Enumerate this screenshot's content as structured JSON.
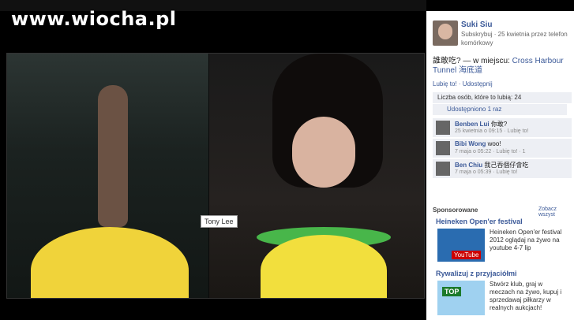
{
  "watermark": "www.wiocha.pl",
  "photo": {
    "tag_label": "Tony Lee"
  },
  "post": {
    "author": "Suki Siu",
    "subtitle": "Subskrybuj · 25 kwietnia przez telefon komórkowy",
    "text": "誰敢吃? — w miejscu:",
    "place": "Cross Harbour Tunnel 海底道",
    "actions": "Lubię to! · Udostępnij",
    "likes": "Liczba osób, które to lubią: 24",
    "shares": "Udostępniono 1 raz"
  },
  "comments": [
    {
      "name": "Benben Lui",
      "text": "你敢?",
      "meta": "25 kwietnia o 09:15 · Lubię to!"
    },
    {
      "name": "Bibi Wong",
      "text": "woo!",
      "meta": "7 maja o 05:22 · Lubię to! · 1"
    },
    {
      "name": "Ben Chiu",
      "text": "我己吞個仔會吃",
      "meta": "7 maja o 05:39 · Lubię to!"
    }
  ],
  "sidebar": {
    "sponsored": "Sponsorowane",
    "see_all": "Zobacz wszyst",
    "ad1": {
      "title": "Heineken Open'er festival",
      "text": "Heineken Open'er festival 2012 oglądaj na żywo na youtube 4-7 lip",
      "badge": "YouTube"
    },
    "ad2": {
      "title": "Rywalizuj z przyjaciółmi",
      "text": "Stwórz klub, graj w meczach na żywo, kupuj i sprzedawaj piłkarzy w realnych aukcjach!",
      "badge": "TOP"
    }
  }
}
